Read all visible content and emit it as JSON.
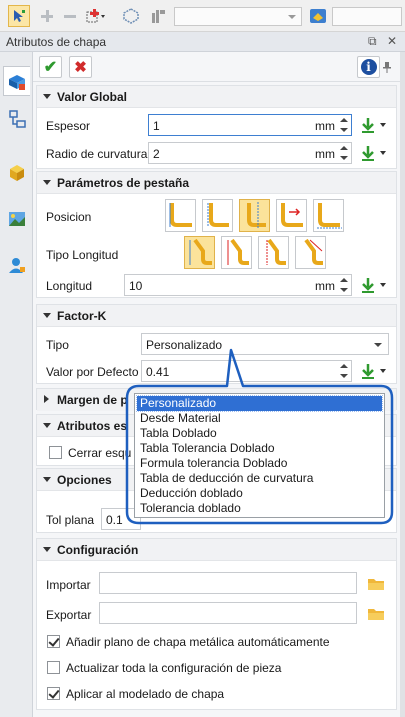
{
  "panel": {
    "title": "Atributos de chapa",
    "ctl_restore": "⧉",
    "ctl_close": "✕"
  },
  "toolbar": {
    "icons": [
      "select-icon",
      "plus-icon",
      "minus-icon",
      "add-component-icon",
      "filter-icon",
      "shape-filter-icon",
      "view-icon"
    ]
  },
  "sidebar": {
    "items": [
      "sheet-attributes-icon",
      "tree-icon",
      "cube-icon",
      "image-icon",
      "user-icon"
    ]
  },
  "actions": {
    "ok": "✔",
    "cancel": "✖",
    "info": "i"
  },
  "valor_global": {
    "header": "Valor Global",
    "espesor_label": "Espesor",
    "espesor_value": "1",
    "espesor_unit": "mm",
    "radio_label": "Radio de curvatura",
    "radio_value": "2",
    "radio_unit": "mm"
  },
  "pestana": {
    "header": "Parámetros de pestaña",
    "posicion_label": "Posicion",
    "tipo_longitud_label": "Tipo Longitud",
    "longitud_label": "Longitud",
    "longitud_value": "10",
    "longitud_unit": "mm"
  },
  "factor_k": {
    "header": "Factor-K",
    "tipo_label": "Tipo",
    "tipo_value": "Personalizado",
    "valor_label": "Valor por Defecto",
    "valor_value": "0.41",
    "options": [
      "Personalizado",
      "Desde Material",
      "Tabla Doblado",
      "Tabla Tolerancia Doblado",
      "Formula tolerancia Doblado",
      "Tabla de deducción de curvatura",
      "Deducción doblado",
      "Tolerancia doblado"
    ]
  },
  "margen": {
    "header": "Margen de p"
  },
  "atributos": {
    "header": "Atributos es",
    "cerrar_label": "Cerrar esqu"
  },
  "opciones": {
    "header": "Opciones",
    "tol_label": "Tol plana",
    "tol_value": "0.1"
  },
  "config": {
    "header": "Configuración",
    "importar_label": "Importar",
    "exportar_label": "Exportar",
    "chk1_label": "Añadir plano de chapa metálica automáticamente",
    "chk2_label": "Actualizar toda la configuración de pieza",
    "chk3_label": "Aplicar al modelado de chapa"
  }
}
